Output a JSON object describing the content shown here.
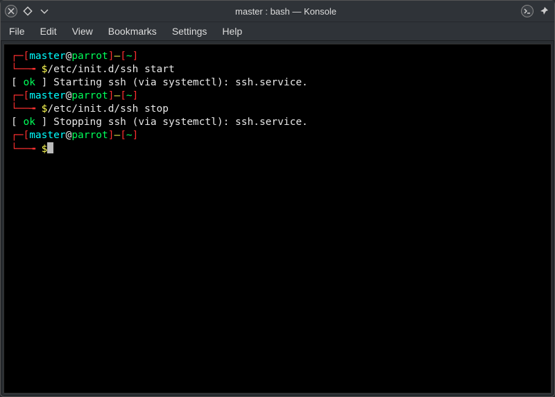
{
  "titlebar": {
    "title": "master : bash — Konsole"
  },
  "menubar": {
    "file": "File",
    "edit": "Edit",
    "view": "View",
    "bookmarks": "Bookmarks",
    "settings": "Settings",
    "help": "Help"
  },
  "prompt": {
    "lbr": "[",
    "rbr": "]",
    "dash": "—",
    "user": "master",
    "at": "@",
    "host": "parrot",
    "tilde": "~",
    "dollar": "$"
  },
  "terminal": {
    "cmd1": "/etc/init.d/ssh start",
    "ok_open": "[ ",
    "ok": "ok",
    "ok_close": " ] ",
    "line1": "Starting ssh (via systemctl): ssh.service.",
    "cmd2": "/etc/init.d/ssh stop",
    "line2": "Stopping ssh (via systemctl): ssh.service."
  }
}
